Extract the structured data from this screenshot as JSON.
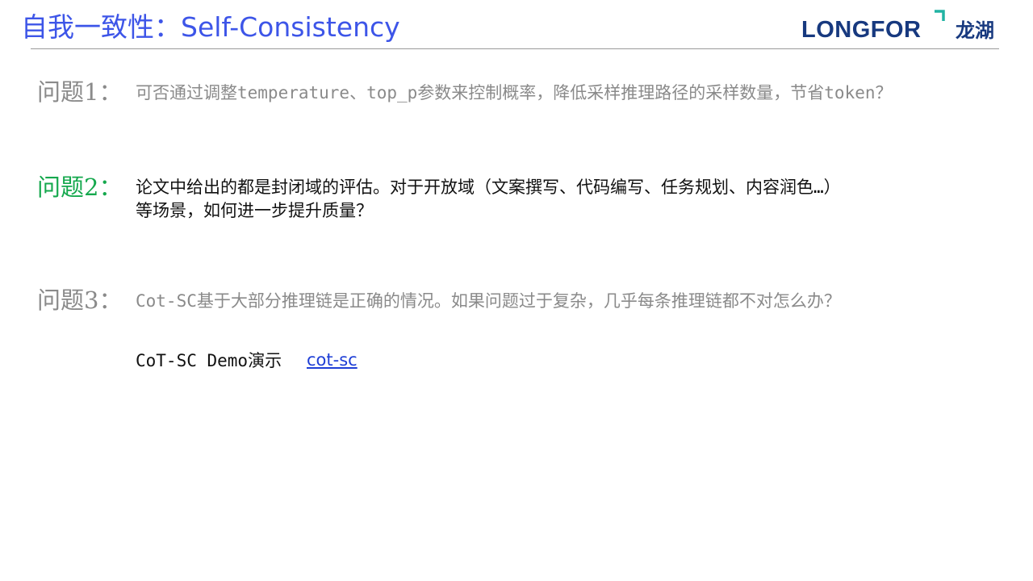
{
  "slide": {
    "title": "自我一致性：Self-Consistency"
  },
  "logo": {
    "text": "LONGFOR",
    "cn": "龙湖",
    "text_color": "#17397f",
    "accent_color": "#21b3a3"
  },
  "questions": [
    {
      "label": "问题1：",
      "lines": [
        "可否通过调整temperature、top_p参数来控制概率，降低采样推理路径的采样数量，节省token？"
      ],
      "label_color": "#8a8a8a",
      "text_color": "#8a8a8a"
    },
    {
      "label": "问题2：",
      "lines": [
        "论文中给出的都是封闭域的评估。对于开放域（文案撰写、代码编写、任务规划、内容润色…）",
        "等场景，如何进一步提升质量？"
      ],
      "label_color": "#15a84d",
      "text_color": "#111111"
    },
    {
      "label": "问题3：",
      "lines": [
        "Cot-SC基于大部分推理链是正确的情况。如果问题过于复杂，几乎每条推理链都不对怎么办？"
      ],
      "label_color": "#8a8a8a",
      "text_color": "#8a8a8a"
    }
  ],
  "demo": {
    "label": "CoT-SC Demo演示",
    "link_text": "cot-sc",
    "link_color": "#1f3fd6"
  },
  "colors": {
    "title": "#3d55e8",
    "rule": "#9a9a9a"
  }
}
